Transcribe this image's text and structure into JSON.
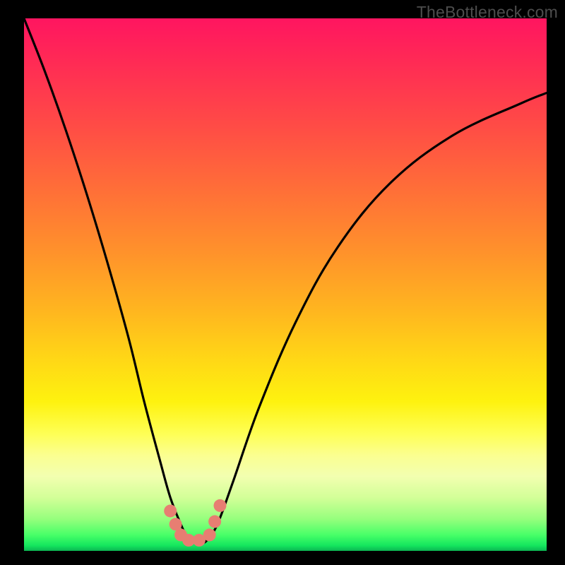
{
  "watermark": "TheBottleneck.com",
  "chart_data": {
    "type": "line",
    "title": "",
    "xlabel": "",
    "ylabel": "",
    "xlim": [
      0,
      100
    ],
    "ylim": [
      0,
      100
    ],
    "series": [
      {
        "name": "bottleneck-curve",
        "x": [
          0,
          4,
          8,
          12,
          16,
          20,
          23,
          26,
          28,
          30,
          31,
          32,
          33,
          34,
          35,
          37,
          40,
          45,
          52,
          60,
          70,
          82,
          95,
          100
        ],
        "y": [
          100,
          90,
          79,
          67,
          54,
          40,
          28,
          17,
          10,
          5,
          3,
          2,
          1.5,
          1.5,
          2,
          5,
          13,
          27,
          43,
          57,
          69,
          78,
          84,
          86
        ]
      }
    ],
    "markers": [
      {
        "name": "dot",
        "x": 28.0,
        "y": 7.5
      },
      {
        "name": "dot",
        "x": 29.0,
        "y": 5.0
      },
      {
        "name": "dot",
        "x": 30.0,
        "y": 3.0
      },
      {
        "name": "dot",
        "x": 31.5,
        "y": 2.0
      },
      {
        "name": "dot",
        "x": 33.5,
        "y": 2.0
      },
      {
        "name": "dot",
        "x": 35.5,
        "y": 3.0
      },
      {
        "name": "dot",
        "x": 36.5,
        "y": 5.5
      },
      {
        "name": "dot",
        "x": 37.5,
        "y": 8.5
      }
    ],
    "marker_color": "#e77e72",
    "curve_color": "#000000"
  }
}
